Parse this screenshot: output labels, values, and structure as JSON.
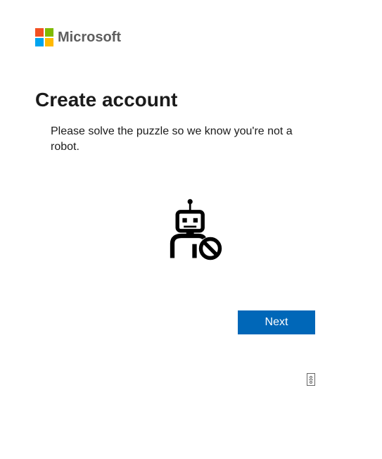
{
  "brand": {
    "name": "Microsoft",
    "logo_colors": {
      "top_left": "#f25022",
      "top_right": "#7fba00",
      "bottom_left": "#00a4ef",
      "bottom_right": "#ffb900"
    }
  },
  "page": {
    "title": "Create account",
    "subtitle": "Please solve the puzzle so we know you're not a robot."
  },
  "illustration": {
    "name": "robot-blocked-icon"
  },
  "actions": {
    "next_label": "Next"
  },
  "accessibility": {
    "audio_challenge_icon": "audio-challenge-icon"
  }
}
